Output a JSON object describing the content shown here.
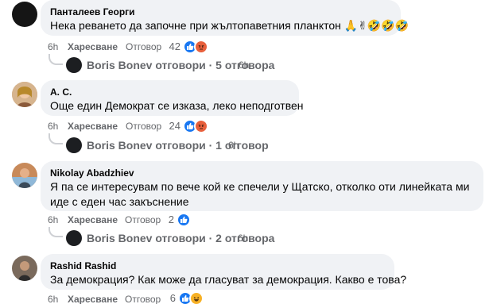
{
  "comments": [
    {
      "author": "Панталеев Георги",
      "text": "Нека реването да започне при жълтопаветния планктон 🙏✌🤣🤣🤣",
      "time": "6h",
      "like_label": "Харесване",
      "reply_label": "Отговор",
      "reaction_count": "42",
      "reactions": [
        "like-icon",
        "angry-icon"
      ],
      "replies": {
        "text": "Boris Bonev отговори · 5 отговора",
        "time": "6h"
      }
    },
    {
      "author": "A. C.",
      "text": "Още един Демократ се изказа, леко неподготвен",
      "time": "6h",
      "like_label": "Харесване",
      "reply_label": "Отговор",
      "reaction_count": "24",
      "reactions": [
        "like-icon",
        "angry-icon"
      ],
      "replies": {
        "text": "Boris Bonev отговори · 1 отговор",
        "time": "6h"
      }
    },
    {
      "author": "Nikolay Abadzhiev",
      "text": "Я па се интересувам по вече кой ке спечели у Щатско, отколко оти линейката ми иде с еден час закъснение",
      "time": "6h",
      "like_label": "Харесване",
      "reply_label": "Отговор",
      "reaction_count": "2",
      "reactions": [
        "like-icon"
      ],
      "replies": {
        "text": "Boris Bonev отговори · 2 отговора",
        "time": "6h"
      }
    },
    {
      "author": "Rashid Rashid",
      "text": "За демокрация? Как може да гласуват за демокрация. Какво е това?",
      "time": "6h",
      "like_label": "Харесване",
      "reply_label": "Отговор",
      "reaction_count": "6",
      "reactions": [
        "like-icon",
        "haha-icon"
      ]
    }
  ],
  "colors": {
    "like": "#1877f2",
    "angry": "#f4a524",
    "haha": "#f7b125",
    "bubble": "#f0f2f5",
    "meta": "#65676b"
  }
}
